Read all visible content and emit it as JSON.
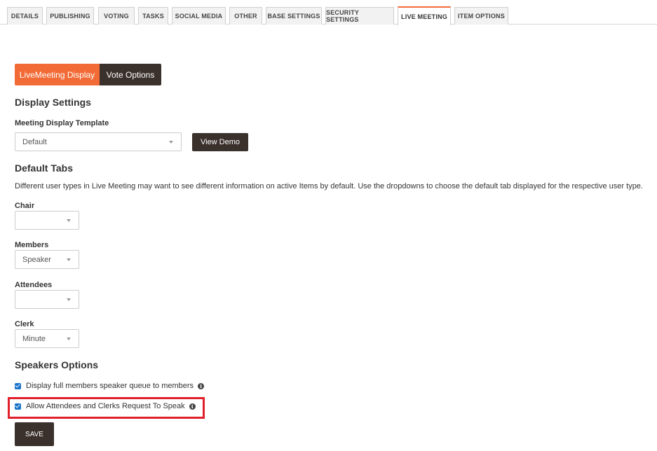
{
  "tabs": [
    {
      "label": "DETAILS"
    },
    {
      "label": "PUBLISHING"
    },
    {
      "label": "VOTING"
    },
    {
      "label": "TASKS"
    },
    {
      "label": "SOCIAL MEDIA"
    },
    {
      "label": "OTHER"
    },
    {
      "label": "BASE SETTINGS"
    },
    {
      "label": "SECURITY SETTINGS"
    },
    {
      "label": "LIVE MEETING"
    },
    {
      "label": "ITEM OPTIONS"
    }
  ],
  "active_tab": "LIVE MEETING",
  "accent_color": "#f26b36",
  "segment": {
    "active": "LiveMeeting Display",
    "inactive": "Vote Options"
  },
  "display_settings": {
    "heading": "Display Settings",
    "template_label": "Meeting Display Template",
    "template_value": "Default",
    "view_demo": "View Demo"
  },
  "default_tabs": {
    "heading": "Default Tabs",
    "description": "Different user types in Live Meeting may want to see different information on active Items by default. Use the dropdowns to choose the default tab displayed for the respective user type.",
    "chair": {
      "label": "Chair",
      "value": ""
    },
    "members": {
      "label": "Members",
      "value": "Speaker"
    },
    "attendees": {
      "label": "Attendees",
      "value": ""
    },
    "clerk": {
      "label": "Clerk",
      "value": "Minute"
    }
  },
  "speakers": {
    "heading": "Speakers Options",
    "opt1": {
      "label": "Display full members speaker queue to members",
      "checked": true
    },
    "opt2": {
      "label": "Allow Attendees and Clerks Request To Speak",
      "checked": true
    }
  },
  "save": "SAVE"
}
